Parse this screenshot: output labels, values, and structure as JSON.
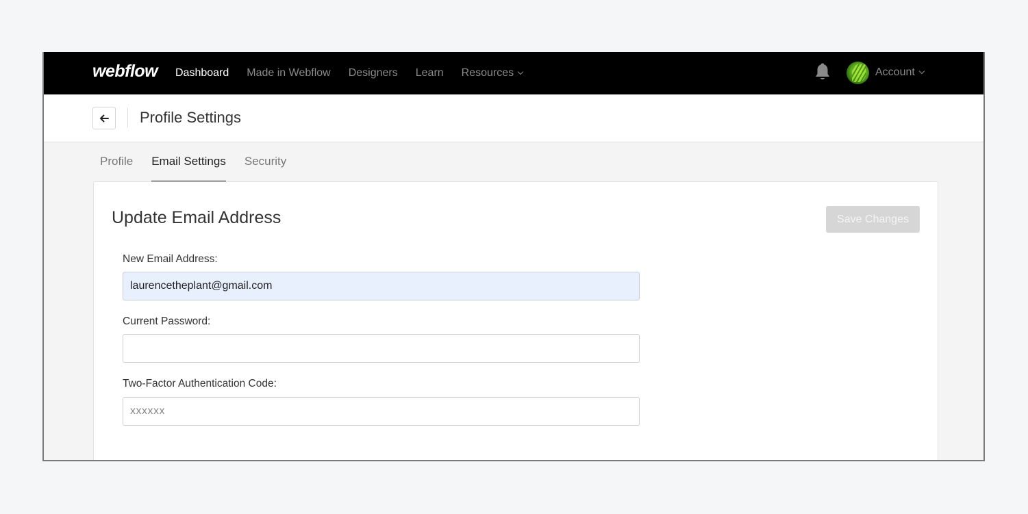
{
  "navbar": {
    "logo": "webflow",
    "links": [
      {
        "label": "Dashboard",
        "active": true
      },
      {
        "label": "Made in Webflow",
        "active": false
      },
      {
        "label": "Designers",
        "active": false
      },
      {
        "label": "Learn",
        "active": false
      },
      {
        "label": "Resources",
        "active": false,
        "dropdown": true
      }
    ],
    "notification_icon": "bell-icon",
    "account_label": "Account"
  },
  "header": {
    "back_icon": "arrow-left-icon",
    "title": "Profile Settings"
  },
  "tabs": [
    {
      "label": "Profile",
      "active": false
    },
    {
      "label": "Email Settings",
      "active": true
    },
    {
      "label": "Security",
      "active": false
    }
  ],
  "card": {
    "title": "Update Email Address",
    "save_label": "Save Changes",
    "fields": [
      {
        "label": "New Email Address:",
        "value": "laurencetheplant@gmail.com",
        "placeholder": ""
      },
      {
        "label": "Current Password:",
        "value": "",
        "placeholder": ""
      },
      {
        "label": "Two-Factor Authentication Code:",
        "value": "",
        "placeholder": "xxxxxx"
      }
    ]
  }
}
